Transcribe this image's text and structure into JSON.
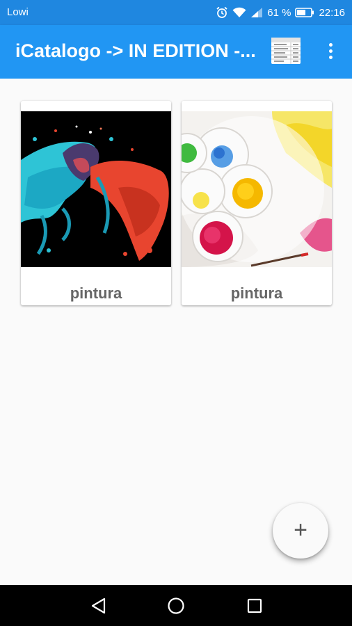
{
  "status_bar": {
    "carrier": "Lowi",
    "battery": "61 %",
    "time": "22:16",
    "icons": [
      "alarm-icon",
      "wifi-icon",
      "signal-icon",
      "battery-icon"
    ]
  },
  "app_bar": {
    "title": "iCatalogo -> IN EDITION -...",
    "actions": [
      "table-view-icon",
      "more-vert-icon"
    ]
  },
  "cards": [
    {
      "label": "pintura",
      "image": "colorful paint splash on black"
    },
    {
      "label": "pintura",
      "image": "watercolor paint palette"
    }
  ],
  "fab": {
    "label": "+"
  },
  "nav_bar": {
    "buttons": [
      "back-icon",
      "home-icon",
      "recents-icon"
    ]
  },
  "colors": {
    "primary": "#2196f3",
    "status_bar": "#1f87e0",
    "background": "#fafafa",
    "card_label": "#666666"
  }
}
